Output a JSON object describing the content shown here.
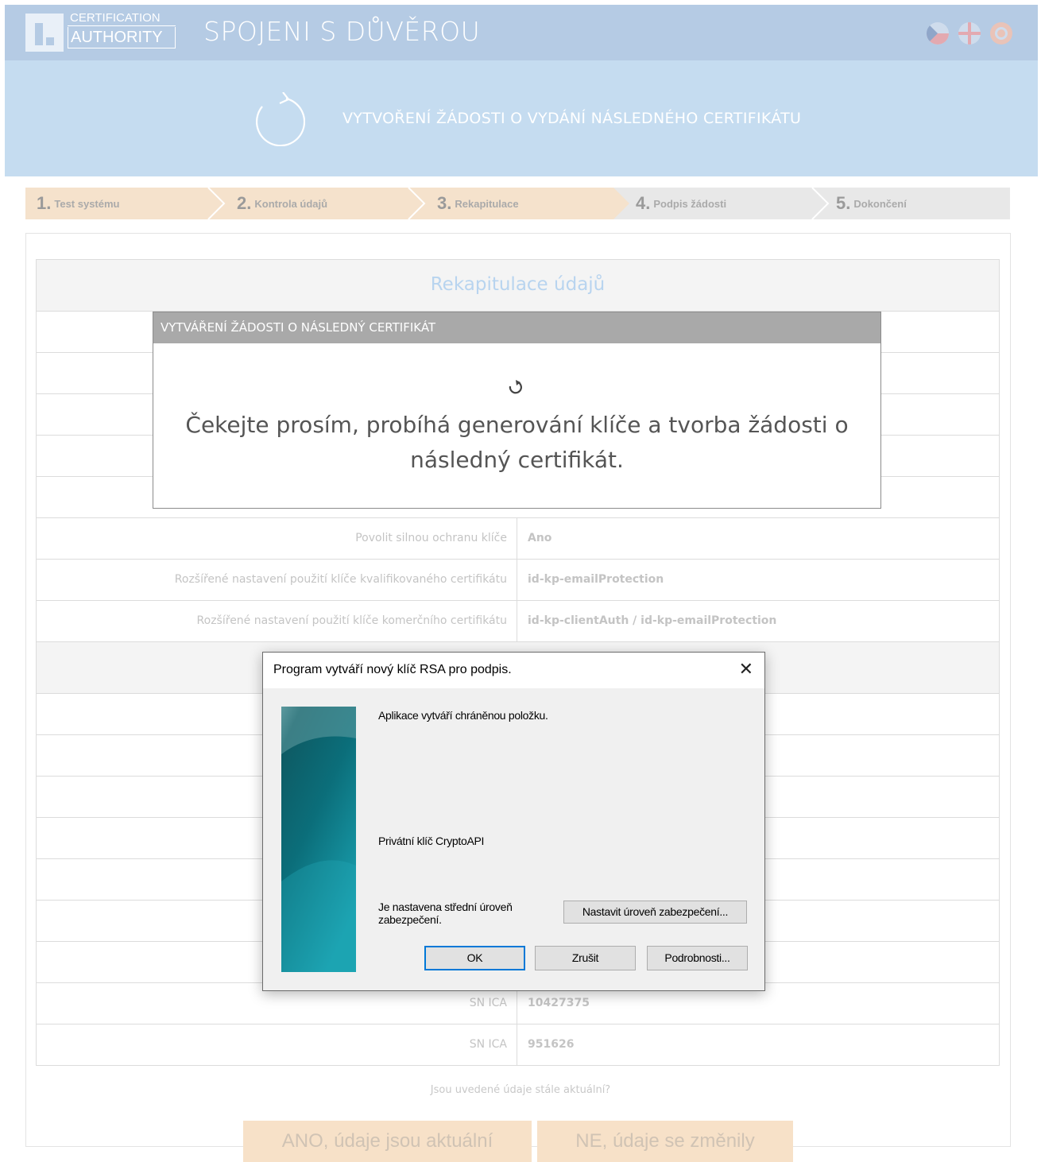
{
  "header": {
    "logo_line1": "CERTIFICATION",
    "logo_line2": "AUTHORITY",
    "title": "SPOJENI S DŮVĚROU",
    "flags": [
      "cz-flag-icon",
      "uk-flag-icon",
      "de-flag-icon"
    ]
  },
  "banner": {
    "icon": "refresh-icon",
    "text": "VYTVOŘENÍ ŽÁDOSTI O VYDÁNÍ NÁSLEDNÉHO CERTIFIKÁTU"
  },
  "wizard": {
    "steps": [
      {
        "num": "1.",
        "label": "Test systému"
      },
      {
        "num": "2.",
        "label": "Kontrola údajů"
      },
      {
        "num": "3.",
        "label": "Rekapitulace"
      },
      {
        "num": "4.",
        "label": "Podpis žádosti"
      },
      {
        "num": "5.",
        "label": "Dokončení"
      }
    ]
  },
  "table": {
    "title": "Rekapitulace údajů",
    "rows": [
      {
        "key": "Povolit silnou ochranu klíče",
        "value": "Ano"
      },
      {
        "key": "Rozšířené nastavení použití klíče kvalifikovaného certifikátu",
        "value": "id-kp-emailProtection"
      },
      {
        "key": "Rozšířené nastavení použití klíče komerčního certifikátu",
        "value": "id-kp-clientAuth / id-kp-emailProtection"
      },
      {
        "key": "SN ICA",
        "value": "10427375"
      },
      {
        "key": "SN ICA",
        "value": "951626"
      }
    ],
    "question": "Jsou uvedené údaje stále aktuální?",
    "yes_button": "ANO, údaje jsou aktuální",
    "no_button": "NE, údaje se změnily"
  },
  "web_modal": {
    "title": "VYTVÁŘENÍ ŽÁDOSTI O NÁSLEDNÝ CERTIFIKÁT",
    "message": "Čekejte prosím, probíhá generování klíče a tvorba žádosti o následný certifikát."
  },
  "win_dialog": {
    "title": "Program vytváří nový klíč RSA pro podpis.",
    "text1": "Aplikace vytváří chráněnou položku.",
    "text2": "Privátní klíč CryptoAPI",
    "text3": "Je nastavena střední úroveň zabezpečení.",
    "set_level_button": "Nastavit úroveň zabezpečení...",
    "ok_button": "OK",
    "cancel_button": "Zrušit",
    "details_button": "Podrobnosti..."
  },
  "colors": {
    "header_bg": "#b5cbe4",
    "banner_bg": "#c5dcf0",
    "wizard_active": "#f5e2cc",
    "wizard_inactive": "#e8e8e8",
    "accent_blue": "#0078d7"
  }
}
